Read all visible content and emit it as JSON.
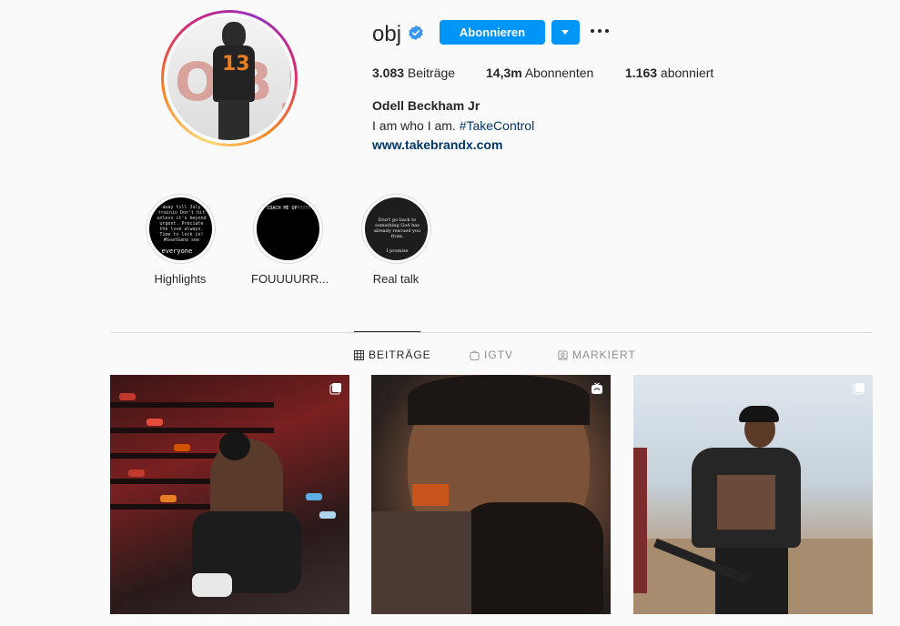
{
  "profile": {
    "username": "obj",
    "follow_label": "Abonnieren",
    "posts_count": "3.083",
    "posts_label": " Beiträge",
    "followers_count": "14,3m",
    "followers_label": " Abonnenten",
    "following_count": "1.163",
    "following_label": " abonniert",
    "full_name": "Odell Beckham Jr",
    "bio_text": "I am who I am. ",
    "bio_hashtag": "#TakeControl",
    "website": "www.takebrandx.com"
  },
  "avatar": {
    "jersey_number": "13",
    "backdrop_letters": "OBJ"
  },
  "highlights": [
    {
      "label": "Highlights",
      "cover_text": "away till July trainin Don't hit unless it's beyond urgent. Preciate the love always. Time to lock in! #GoatGang see y'all soooon",
      "cover_caption": "everyone"
    },
    {
      "label": "FOUUUURR...",
      "cover_text": "COACH ME UP!!!!!"
    },
    {
      "label": "Real talk",
      "cover_text": "Don't go back to something God has already rescued you from.",
      "cover_caption": "I promise"
    }
  ],
  "tabs": [
    {
      "label": "BEITRÄGE",
      "icon": "grid-icon",
      "active": true
    },
    {
      "label": "IGTV",
      "icon": "igtv-icon",
      "active": false
    },
    {
      "label": "MARKIERT",
      "icon": "tagged-icon",
      "active": false
    }
  ],
  "posts": [
    {
      "type_icon": "carousel-icon"
    },
    {
      "type_icon": "igtv-icon"
    },
    {
      "type_icon": "carousel-icon"
    }
  ],
  "colors": {
    "accent": "#0095f6",
    "link": "#00376b",
    "verified": "#3897f0"
  }
}
